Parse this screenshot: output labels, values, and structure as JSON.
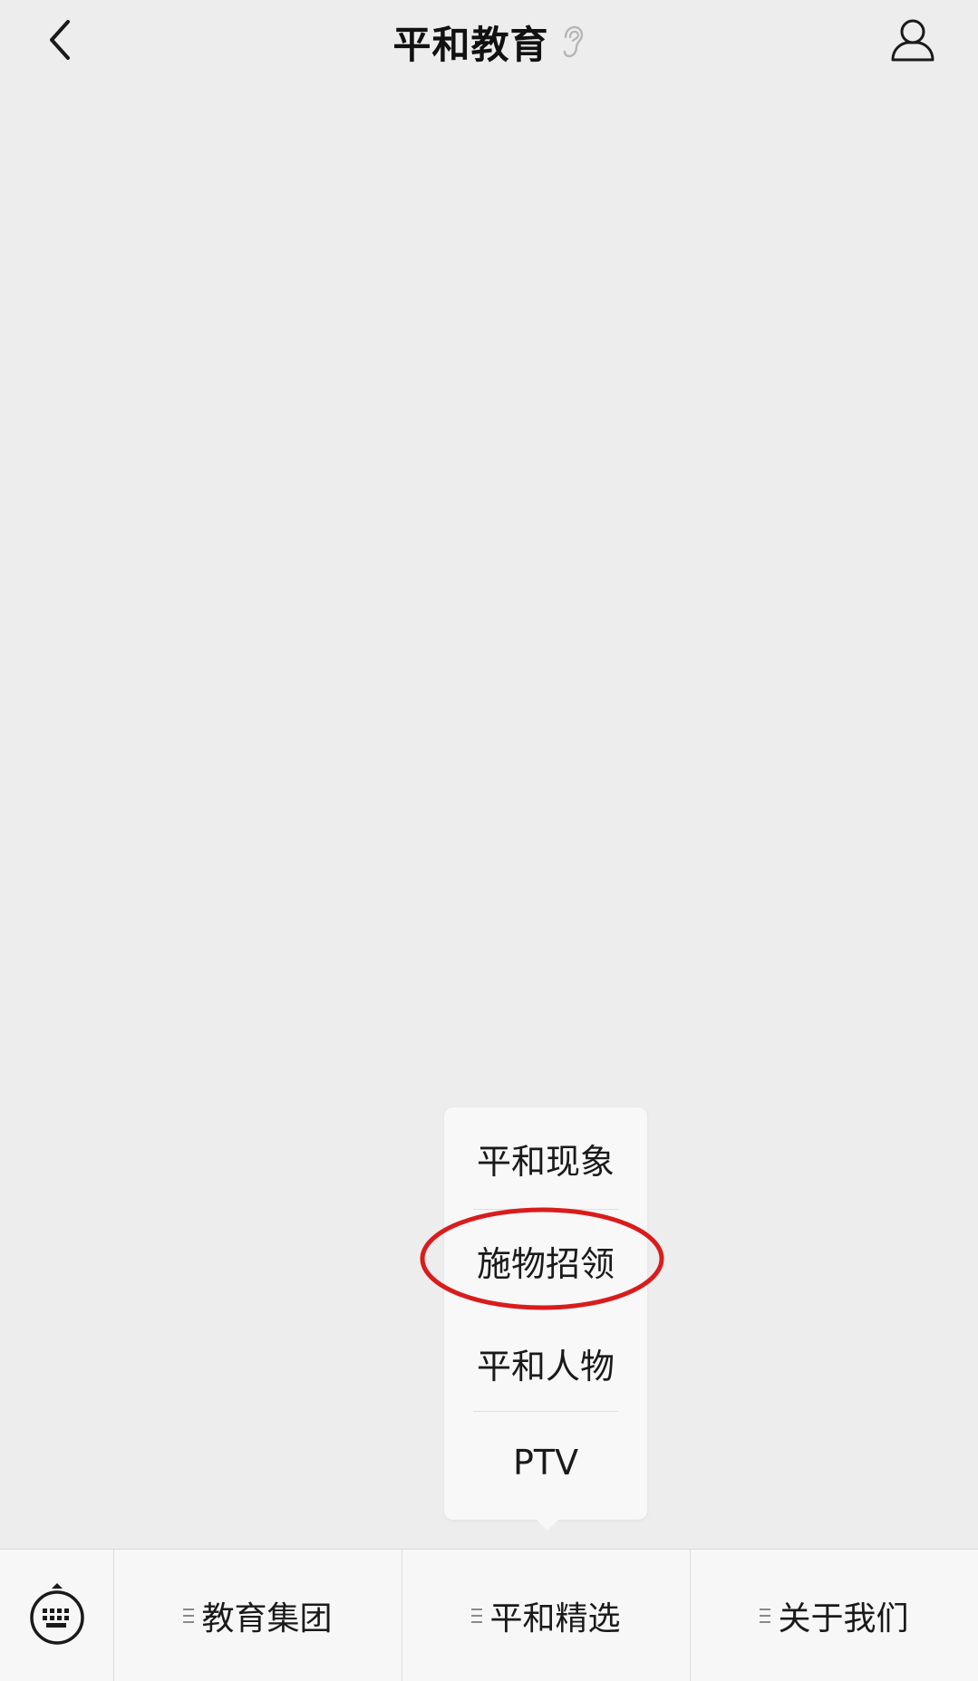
{
  "header": {
    "title": "平和教育",
    "back_icon": "chevron-left-icon",
    "ear_icon": "ear-icon",
    "profile_icon": "person-icon"
  },
  "popup_menu": {
    "items": [
      {
        "label": "平和现象"
      },
      {
        "label": "施物招领"
      },
      {
        "label": "平和人物"
      },
      {
        "label": "PTV"
      }
    ],
    "highlight_color": "#d91c1c"
  },
  "bottom_bar": {
    "keyboard_icon": "keyboard-icon",
    "tabs": [
      {
        "label": "教育集团"
      },
      {
        "label": "平和精选"
      },
      {
        "label": "关于我们"
      }
    ]
  }
}
